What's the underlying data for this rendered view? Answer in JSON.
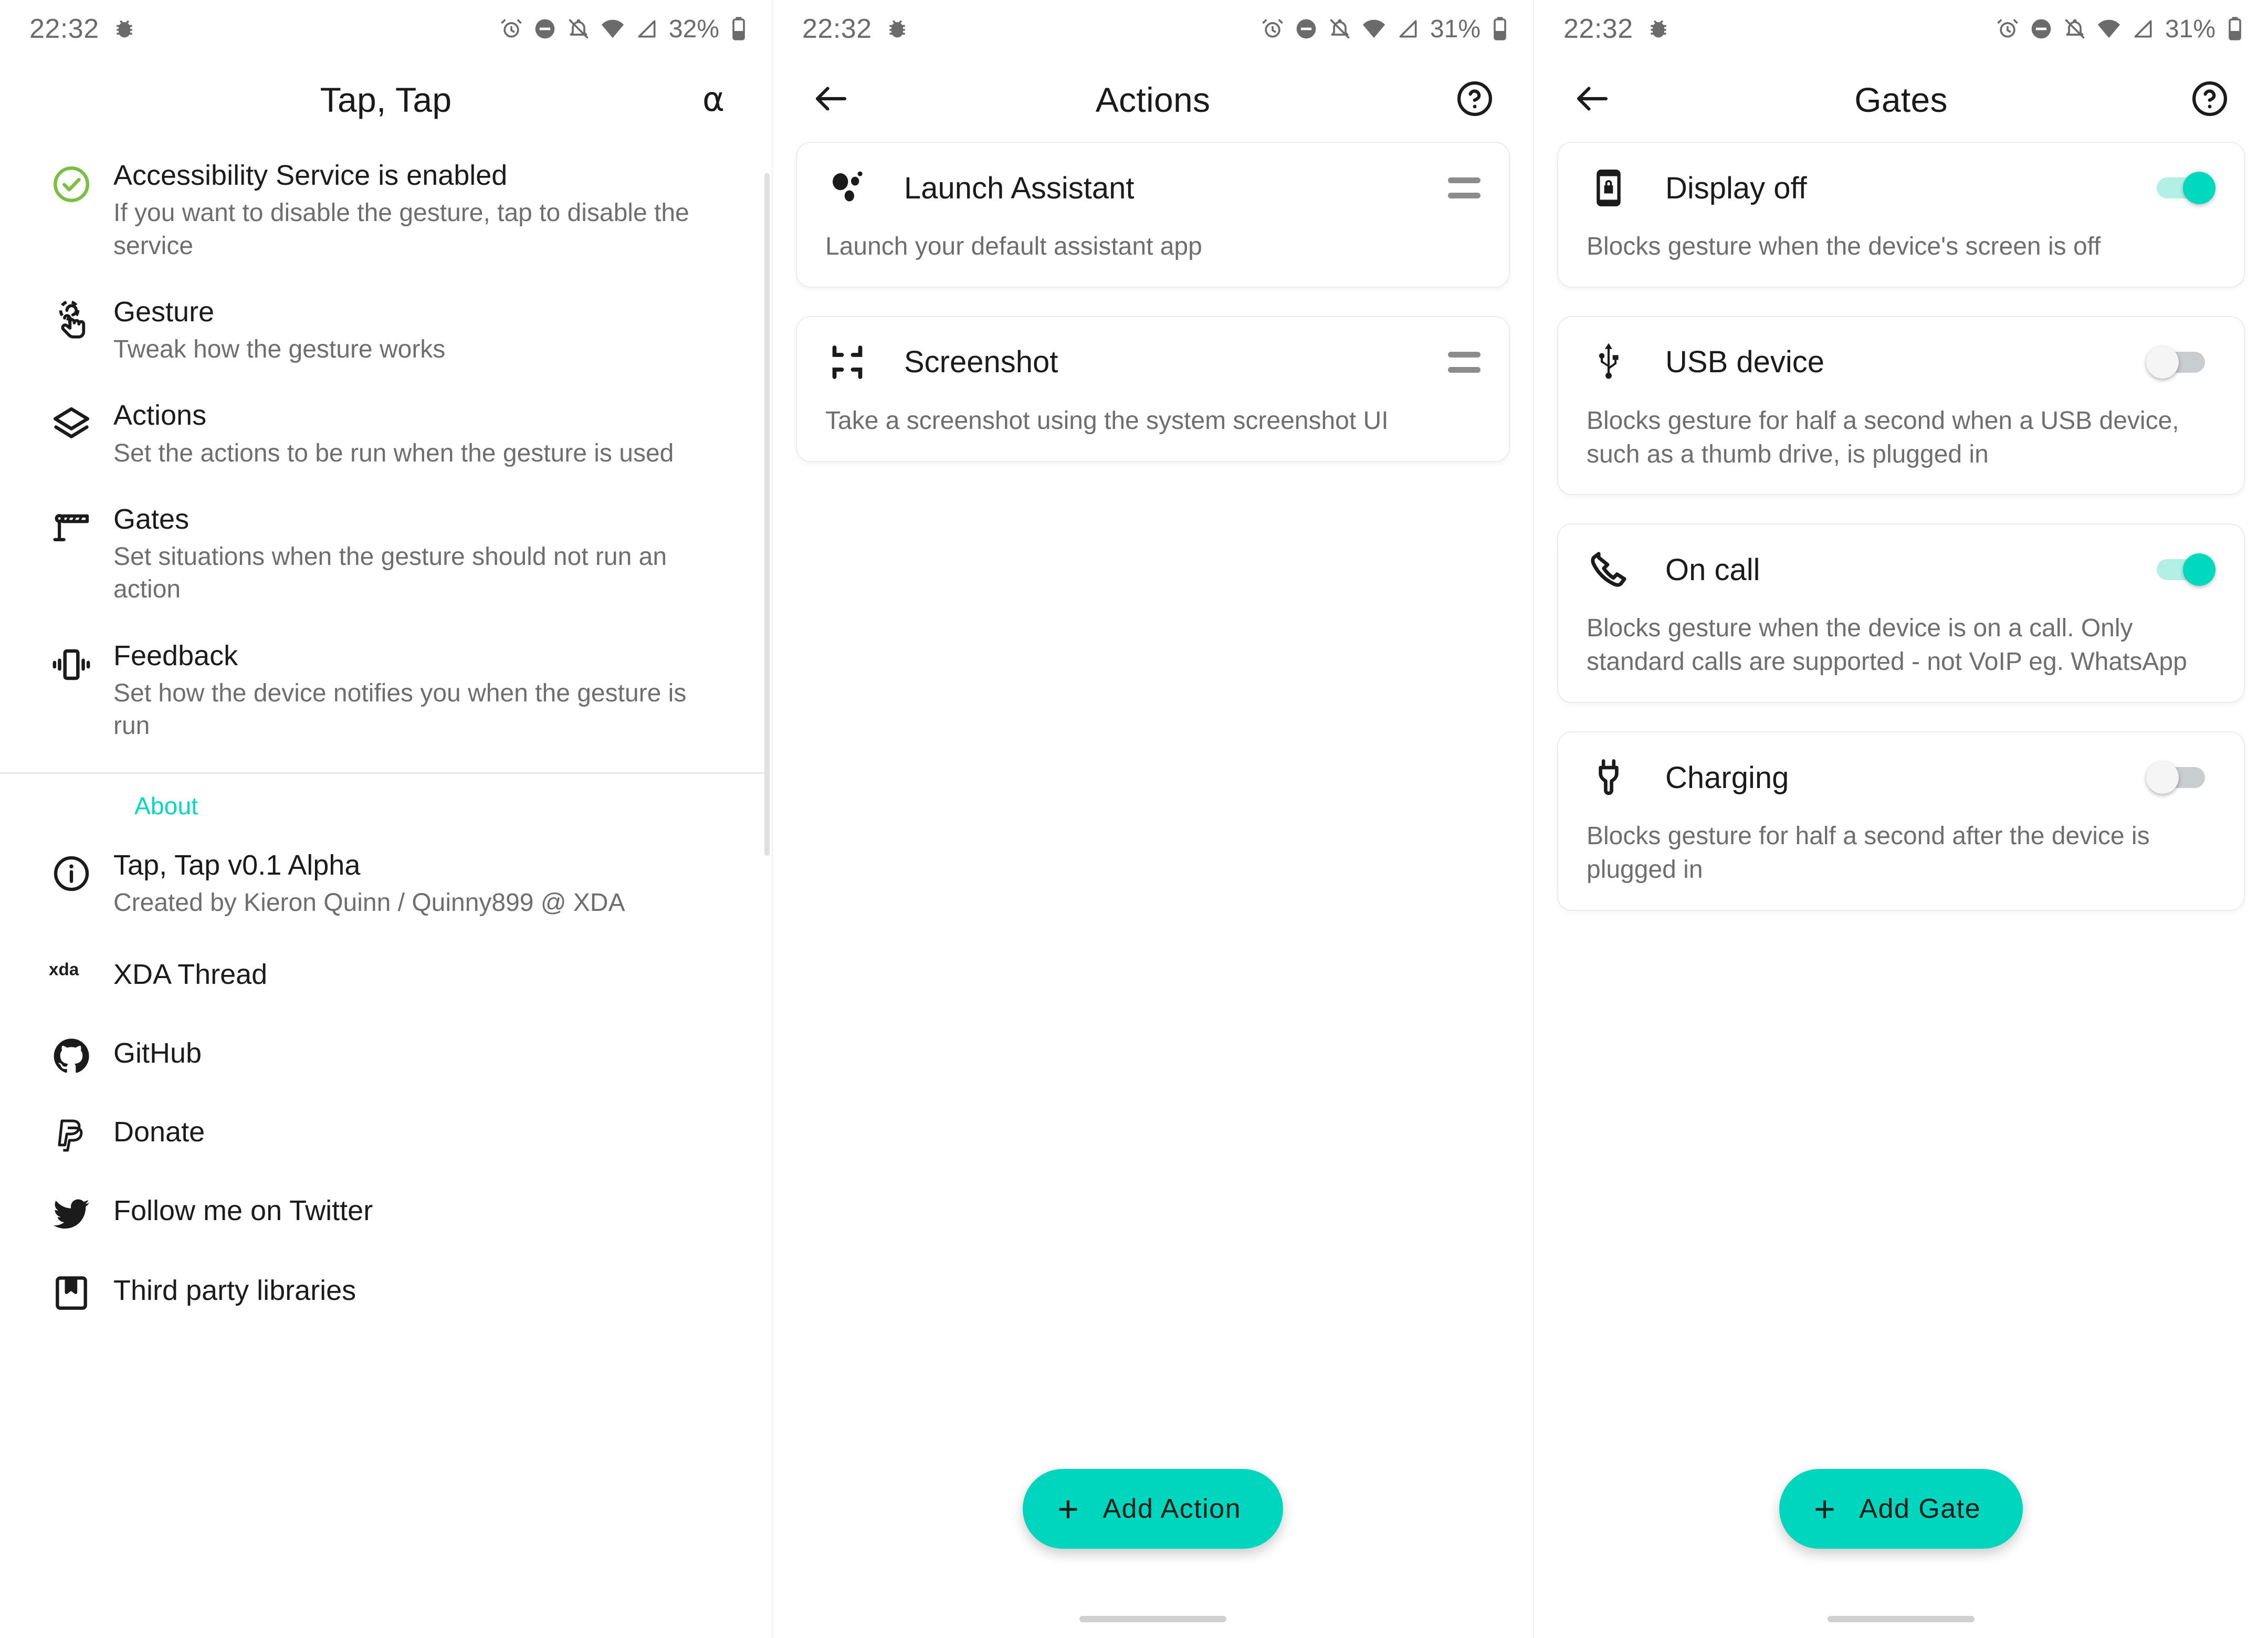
{
  "statusbar": {
    "time": "22:32",
    "battery_1": "32%",
    "battery_2": "31%",
    "battery_3": "31%",
    "icons": [
      "bug-icon",
      "alarm-icon",
      "do-not-disturb-icon",
      "notifications-off-icon",
      "wifi-icon",
      "cell-signal-icon",
      "battery-icon"
    ]
  },
  "accent_color": "#00d9bd",
  "screen1": {
    "appbar": {
      "title": "Tap, Tap",
      "action_label": "α"
    },
    "items": [
      {
        "icon": "check-circle-icon",
        "title": "Accessibility Service is enabled",
        "subtitle": "If you want to disable the gesture, tap to disable the service"
      },
      {
        "icon": "touch-gesture-icon",
        "title": "Gesture",
        "subtitle": "Tweak how the gesture works"
      },
      {
        "icon": "layers-icon",
        "title": "Actions",
        "subtitle": "Set the actions to be run when the gesture is used"
      },
      {
        "icon": "boom-gate-icon",
        "title": "Gates",
        "subtitle": "Set situations when the gesture should not run an action"
      },
      {
        "icon": "vibration-icon",
        "title": "Feedback",
        "subtitle": "Set how the device notifies you when the gesture is run"
      }
    ],
    "about_header": "About",
    "about_items": [
      {
        "icon": "info-icon",
        "title": "Tap, Tap v0.1 Alpha",
        "subtitle": "Created by Kieron Quinn / Quinny899 @ XDA"
      },
      {
        "icon": "xda-icon",
        "title": "XDA Thread"
      },
      {
        "icon": "github-icon",
        "title": "GitHub"
      },
      {
        "icon": "paypal-icon",
        "title": "Donate"
      },
      {
        "icon": "twitter-icon",
        "title": "Follow me on Twitter"
      },
      {
        "icon": "book-icon",
        "title": "Third party libraries"
      }
    ]
  },
  "screen2": {
    "appbar": {
      "back": "back-arrow-icon",
      "title": "Actions",
      "help": "help-circle-icon"
    },
    "cards": [
      {
        "icon": "assistant-icon",
        "title": "Launch Assistant",
        "description": "Launch your default assistant app",
        "handle": "drag-handle-icon"
      },
      {
        "icon": "screenshot-icon",
        "title": "Screenshot",
        "description": "Take a screenshot using the system screenshot UI",
        "handle": "drag-handle-icon"
      }
    ],
    "fab": {
      "label": "Add Action",
      "icon": "plus-icon"
    }
  },
  "screen3": {
    "appbar": {
      "back": "back-arrow-icon",
      "title": "Gates",
      "help": "help-circle-icon"
    },
    "cards": [
      {
        "icon": "phone-lock-icon",
        "title": "Display off",
        "description": "Blocks gesture when the device's screen is off",
        "toggle": "on"
      },
      {
        "icon": "usb-icon",
        "title": "USB device",
        "description": "Blocks gesture for half a second when a USB device, such as a thumb drive, is plugged in",
        "toggle": "off"
      },
      {
        "icon": "phone-call-icon",
        "title": "On call",
        "description": "Blocks gesture when the device is on a call. Only standard calls are supported - not VoIP eg. WhatsApp",
        "toggle": "on"
      },
      {
        "icon": "power-plug-icon",
        "title": "Charging",
        "description": "Blocks gesture for half a second after the device is plugged in",
        "toggle": "off"
      }
    ],
    "fab": {
      "label": "Add Gate",
      "icon": "plus-icon"
    }
  }
}
